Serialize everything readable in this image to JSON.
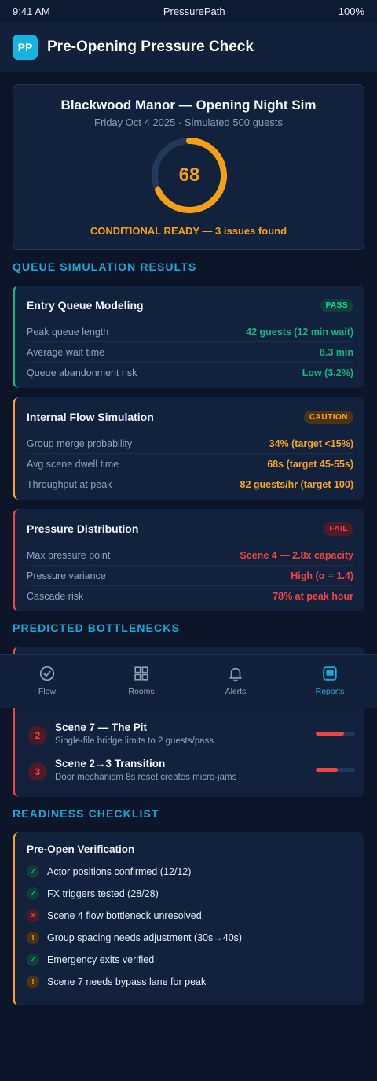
{
  "status_bar": {
    "time": "9:41 AM",
    "app": "PressurePath",
    "battery": "100%"
  },
  "header": {
    "logo_text": "PP",
    "title": "Pre-Opening Pressure Check"
  },
  "summary": {
    "title": "Blackwood Manor — Opening Night Sim",
    "subtitle": "Friday Oct 4 2025 · Simulated 500 guests",
    "score": "68",
    "score_fraction": 0.68,
    "status": "CONDITIONAL READY — 3 issues found",
    "accent": "#f59f15"
  },
  "sections": {
    "queue": "QUEUE SIMULATION RESULTS",
    "bottlenecks": "PREDICTED BOTTLENECKS",
    "checklist": "READINESS CHECKLIST"
  },
  "cards": [
    {
      "title": "Entry Queue Modeling",
      "badge": "PASS",
      "rows": [
        {
          "label": "Peak queue length",
          "value": "42 guests (12 min wait)"
        },
        {
          "label": "Average wait time",
          "value": "8.3 min"
        },
        {
          "label": "Queue abandonment risk",
          "value": "Low (3.2%)"
        }
      ]
    },
    {
      "title": "Internal Flow Simulation",
      "badge": "CAUTION",
      "rows": [
        {
          "label": "Group merge probability",
          "value": "34% (target <15%)"
        },
        {
          "label": "Avg scene dwell time",
          "value": "68s (target 45-55s)"
        },
        {
          "label": "Throughput at peak",
          "value": "82 guests/hr (target 100)"
        }
      ]
    },
    {
      "title": "Pressure Distribution",
      "badge": "FAIL",
      "rows": [
        {
          "label": "Max pressure point",
          "value": "Scene 4 — 2.8x capacity"
        },
        {
          "label": "Pressure variance",
          "value": "High (σ = 1.4)"
        },
        {
          "label": "Cascade risk",
          "value": "78% at peak hour"
        }
      ]
    }
  ],
  "bottlenecks": [
    {
      "num": "2",
      "title": "Scene 7 — The Pit",
      "desc": "Single-file bridge limits to 2 guests/pass",
      "severity": 0.72
    },
    {
      "num": "3",
      "title": "Scene 2→3 Transition",
      "desc": "Door mechanism 8s reset creates micro-jams",
      "severity": 0.56
    }
  ],
  "nav": [
    {
      "label": "Flow",
      "icon": "check-circle-icon"
    },
    {
      "label": "Rooms",
      "icon": "grid-icon"
    },
    {
      "label": "Alerts",
      "icon": "bell-icon"
    },
    {
      "label": "Reports",
      "icon": "report-icon",
      "active": true
    }
  ],
  "checklist": {
    "title": "Pre-Open Verification",
    "items": [
      {
        "status": "ok",
        "glyph": "✓",
        "text": "Actor positions confirmed (12/12)"
      },
      {
        "status": "ok",
        "glyph": "✓",
        "text": "FX triggers tested (28/28)"
      },
      {
        "status": "bad",
        "glyph": "✕",
        "text": "Scene 4 flow bottleneck unresolved"
      },
      {
        "status": "warn",
        "glyph": "!",
        "text": "Group spacing needs adjustment (30s→40s)"
      },
      {
        "status": "ok",
        "glyph": "✓",
        "text": "Emergency exits verified"
      },
      {
        "status": "warn",
        "glyph": "!",
        "text": "Scene 7 needs bypass lane for peak"
      }
    ]
  }
}
